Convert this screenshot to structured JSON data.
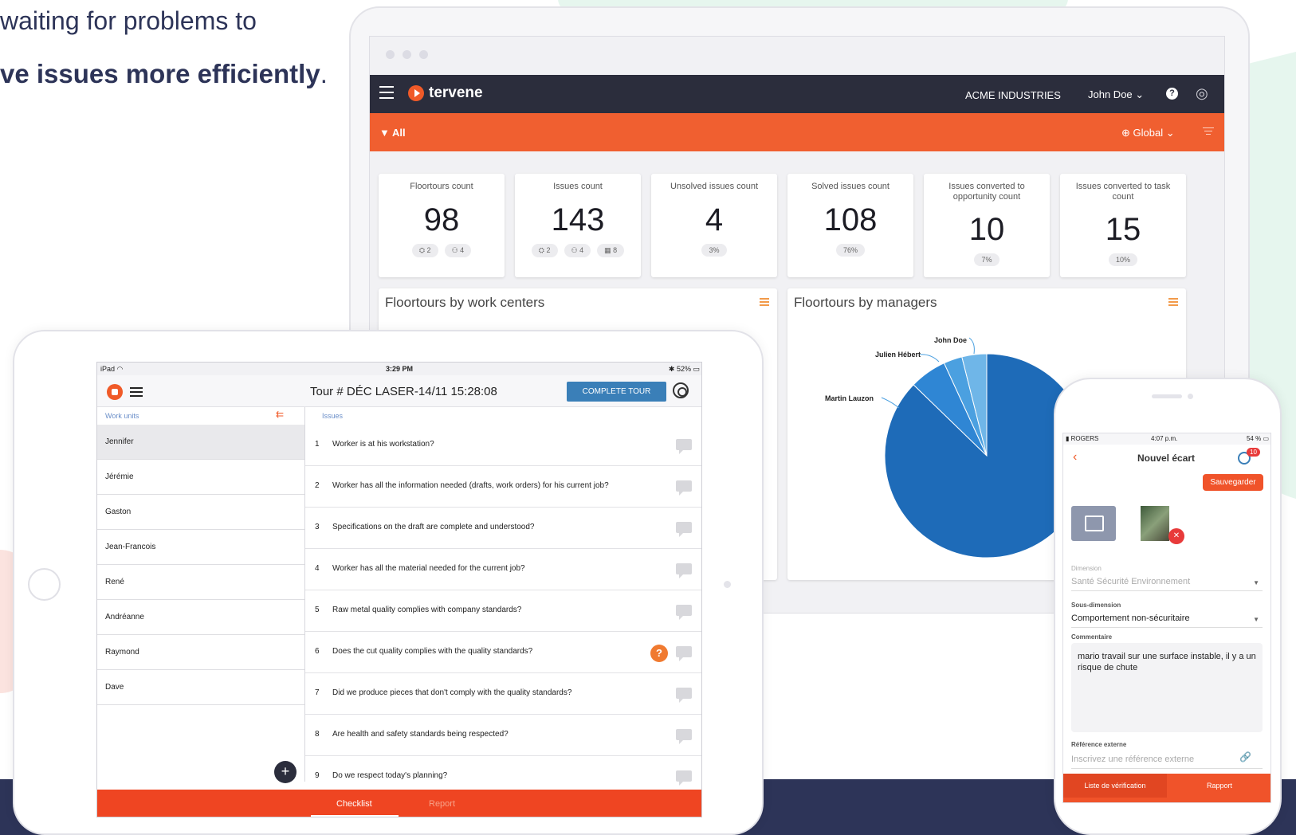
{
  "marketing": {
    "line1": "waiting for problems to",
    "line2_bold": "ve issues more efficiently",
    "line2_end": "."
  },
  "dashboard": {
    "brand": "tervene",
    "company": "ACME INDUSTRIES",
    "user": "John Doe",
    "help": "?",
    "filter_all": "All",
    "scope": "Global",
    "kpis": [
      {
        "label": "Floortours count",
        "value": "98",
        "chips": [
          "2",
          "4"
        ]
      },
      {
        "label": "Issues count",
        "value": "143",
        "chips": [
          "2",
          "4",
          "8"
        ]
      },
      {
        "label": "Unsolved issues count",
        "value": "4",
        "chips": [
          "3%"
        ]
      },
      {
        "label": "Solved issues count",
        "value": "108",
        "chips": [
          "76%"
        ]
      },
      {
        "label": "Issues converted to opportunity count",
        "value": "10",
        "chips": [
          "7%"
        ]
      },
      {
        "label": "Issues converted to task count",
        "value": "15",
        "chips": [
          "10%"
        ]
      }
    ],
    "panel_left_title": "Floortours by work centers",
    "panel_right_title": "Floortours by managers"
  },
  "chart_data": {
    "type": "pie",
    "title": "Floortours by managers",
    "categories": [
      "Martin Lauzon",
      "Julien Hébert",
      "John Doe"
    ],
    "values": [
      89,
      6,
      3
    ],
    "extra_slice_value": 4,
    "colors": [
      "#1e6bb8",
      "#2f86d4",
      "#4ba0e0",
      "#6fb6e8"
    ]
  },
  "tablet": {
    "status_left": "iPad",
    "status_time": "3:29 PM",
    "status_right": "52%",
    "title": "Tour # DÉC LASER-14/11 15:28:08",
    "complete_label": "COMPLETE TOUR",
    "units_header": "Work units",
    "issues_header": "Issues",
    "units": [
      "Jennifer",
      "Jérémie",
      "Gaston",
      "Jean-Francois",
      "René",
      "Andréanne",
      "Raymond",
      "Dave"
    ],
    "issues": [
      {
        "num": "1",
        "text": "Worker is at his workstation?"
      },
      {
        "num": "2",
        "text": "Worker has all the information needed (drafts, work orders) for his current job?"
      },
      {
        "num": "3",
        "text": "Specifications on the draft are complete and understood?"
      },
      {
        "num": "4",
        "text": "Worker has all the material needed for the current job?"
      },
      {
        "num": "5",
        "text": "Raw metal quality complies with company standards?"
      },
      {
        "num": "6",
        "text": "Does the cut quality complies with the quality standards?"
      },
      {
        "num": "7",
        "text": "Did we produce pieces that don't comply with the quality standards?"
      },
      {
        "num": "8",
        "text": "Are health and safety standards being respected?"
      },
      {
        "num": "9",
        "text": "Do we respect today's planning?"
      }
    ],
    "tab_checklist": "Checklist",
    "tab_report": "Report"
  },
  "phone": {
    "status_carrier": "ROGERS",
    "status_time": "4:07 p.m.",
    "status_battery": "54 %",
    "title": "Nouvel écart",
    "badge": "10",
    "save_label": "Sauvegarder",
    "dimension_label": "Dimension",
    "dimension_value": "Santé Sécurité Environnement",
    "subdimension_label": "Sous-dimension",
    "subdimension_value": "Comportement non-sécuritaire",
    "comment_label": "Commentaire",
    "comment_value": "mario travail sur une surface instable, il y a un risque de chute",
    "external_ref_label": "Référence externe",
    "external_ref_placeholder": "Inscrivez une référence externe",
    "tab_checklist": "Liste de vérification",
    "tab_report": "Rapport"
  }
}
